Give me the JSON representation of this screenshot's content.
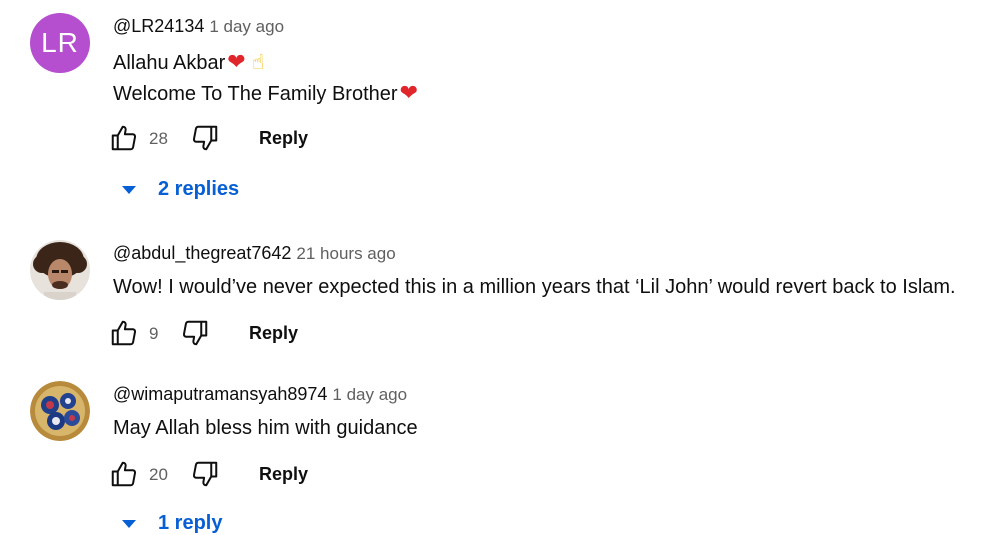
{
  "comments": [
    {
      "avatar_text": "LR",
      "avatar_color": "#b54fcf",
      "author": "@LR24134",
      "time": "1 day ago",
      "lines": [
        "Allahu Akbar",
        "Welcome To The Family Brother"
      ],
      "emoji": {
        "heart": "❤",
        "finger": "☝"
      },
      "likes": "28",
      "reply_label": "Reply",
      "replies_label": "2 replies"
    },
    {
      "author": "@abdul_thegreat7642",
      "time": "21 hours ago",
      "lines": [
        "Wow! I would’ve never expected this in a million years that ‘Lil John’ would revert back to Islam."
      ],
      "likes": "9",
      "reply_label": "Reply"
    },
    {
      "author": "@wimaputramansyah8974",
      "time": "1 day ago",
      "lines": [
        "May Allah bless him with guidance"
      ],
      "likes": "20",
      "reply_label": "Reply",
      "replies_label": "1 reply"
    }
  ],
  "icons": {
    "like": "thumbs-up-icon",
    "dislike": "thumbs-down-icon",
    "expand": "caret-down-icon"
  },
  "colors": {
    "link_blue": "#065fd4",
    "secondary_text": "#606060",
    "heart_red": "#e0252b"
  }
}
